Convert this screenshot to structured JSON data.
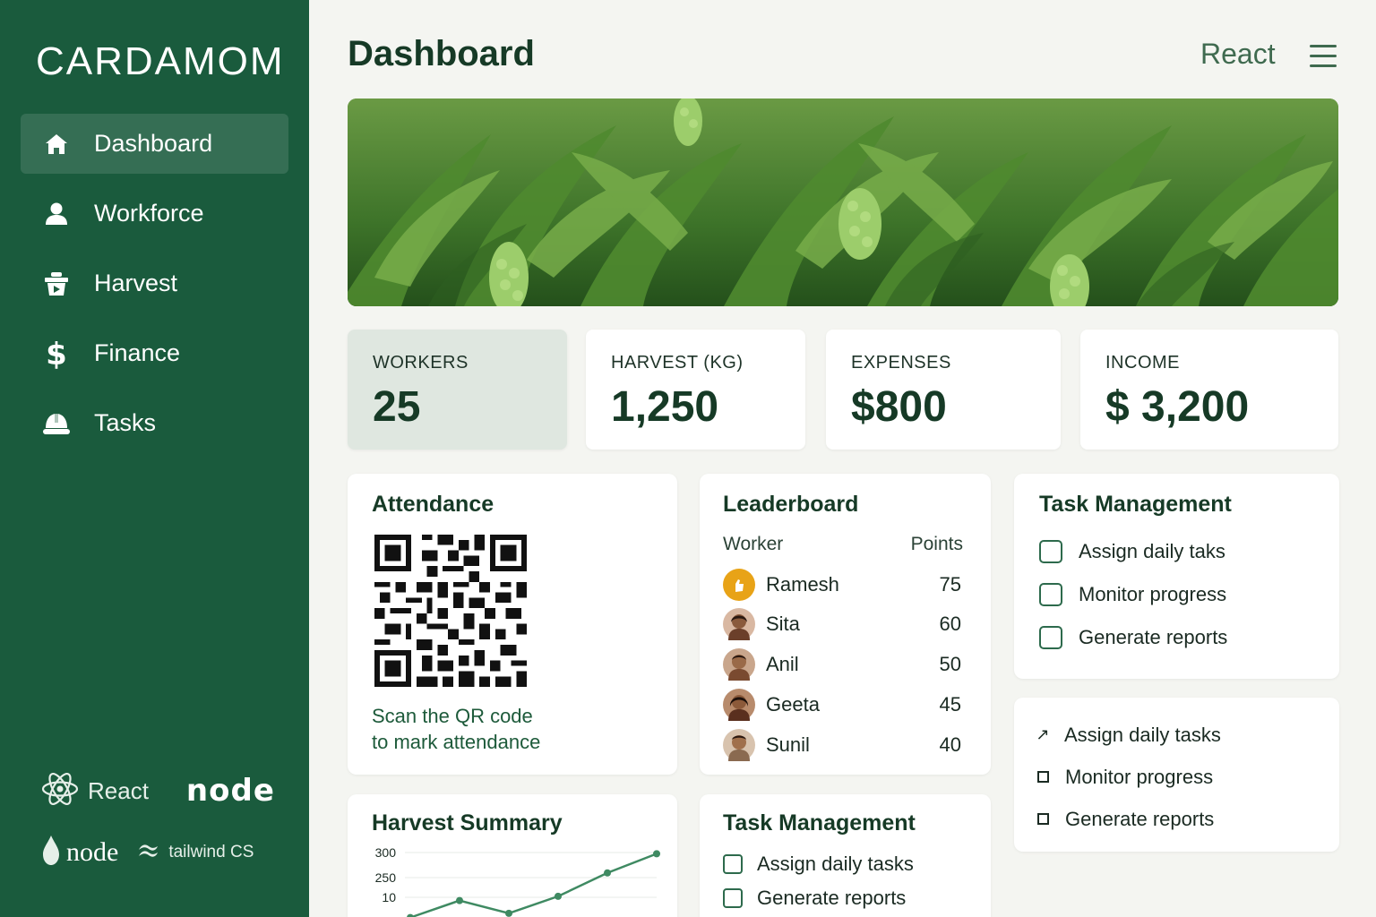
{
  "app": {
    "brand": "CARDAMOM"
  },
  "sidebar": {
    "items": [
      {
        "label": "Dashboard",
        "icon": "home-icon",
        "active": true
      },
      {
        "label": "Workforce",
        "icon": "user-icon"
      },
      {
        "label": "Harvest",
        "icon": "basket-icon"
      },
      {
        "label": "Finance",
        "icon": "dollar-icon"
      },
      {
        "label": "Tasks",
        "icon": "helmet-icon"
      }
    ],
    "tech": {
      "react": "React",
      "node_styled": "node",
      "node": "node",
      "tailwind": "tailwind CS"
    }
  },
  "header": {
    "title": "Dashboard",
    "right_label": "React"
  },
  "stats": [
    {
      "label": "WORKERS",
      "value": "25"
    },
    {
      "label": "HARVEST (KG)",
      "value": "1,250"
    },
    {
      "label": "EXPENSES",
      "value": "$800"
    },
    {
      "label": "INCOME",
      "value": "$ 3,200"
    }
  ],
  "attendance": {
    "title": "Attendance",
    "line1": "Scan the QR code",
    "line2": "to mark attendance"
  },
  "leaderboard": {
    "title": "Leaderboard",
    "col_worker": "Worker",
    "col_points": "Points",
    "rows": [
      {
        "name": "Ramesh",
        "points": "75"
      },
      {
        "name": "Sita",
        "points": "60"
      },
      {
        "name": "Anil",
        "points": "50"
      },
      {
        "name": "Geeta",
        "points": "45"
      },
      {
        "name": "Sunil",
        "points": "40"
      }
    ]
  },
  "task_management": {
    "title": "Task Management",
    "items": [
      "Assign daily taks",
      "Monitor progress",
      "Generate reports"
    ]
  },
  "task_list": {
    "items": [
      "Assign daily tasks",
      "Monitor progress",
      "Generate reports"
    ]
  },
  "harvest_summary": {
    "title": "Harvest Summary"
  },
  "task_management_2": {
    "title": "Task Management",
    "items": [
      "Assign daily tasks",
      "Generate reports"
    ]
  },
  "chart_data": {
    "type": "line",
    "title": "Harvest Summary",
    "yticks": [
      "300",
      "250",
      "10"
    ],
    "x": [
      1,
      2,
      3,
      4,
      5,
      6
    ],
    "values": [
      10,
      90,
      30,
      110,
      220,
      310
    ],
    "ylim": [
      0,
      320
    ],
    "grid": true,
    "color": "#3f8a62"
  },
  "colors": {
    "sidebar": "#1a5b3d",
    "accent": "#2d6a4c",
    "background": "#f4f5f1"
  }
}
